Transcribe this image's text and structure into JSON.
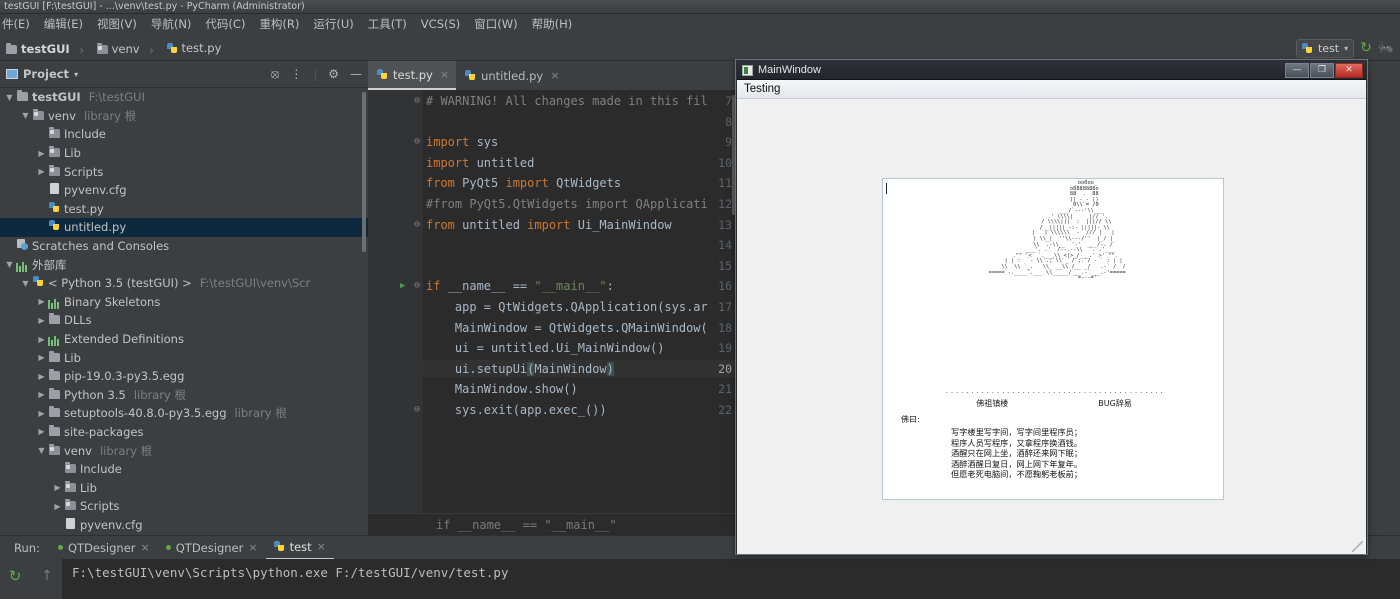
{
  "window": {
    "title": "testGUI [F:\\testGUI] - ...\\venv\\test.py - PyCharm (Administrator)"
  },
  "menubar": {
    "items": [
      {
        "label": "件(E)"
      },
      {
        "label": "编辑(E)"
      },
      {
        "label": "视图(V)"
      },
      {
        "label": "导航(N)"
      },
      {
        "label": "代码(C)"
      },
      {
        "label": "重构(R)"
      },
      {
        "label": "运行(U)"
      },
      {
        "label": "工具(T)"
      },
      {
        "label": "VCS(S)"
      },
      {
        "label": "窗口(W)"
      },
      {
        "label": "帮助(H)"
      }
    ]
  },
  "breadcrumb": {
    "items": [
      {
        "label": "testGUI",
        "icon": "folder-icon"
      },
      {
        "label": "venv",
        "icon": "folder-icon"
      },
      {
        "label": "test.py",
        "icon": "python-file-icon"
      }
    ],
    "separator": "›"
  },
  "toolbar_right": {
    "run_config": "test",
    "dropdown_caret": "▾",
    "rerun_icon": "rerun-icon",
    "debug_icon": "debug-icon"
  },
  "project_panel": {
    "title": "Project",
    "caret": "▾",
    "tools": [
      "target-icon",
      "collapse-all-icon",
      "settings-icon",
      "hide-icon"
    ],
    "tree": [
      {
        "depth": 0,
        "arrow": "▼",
        "icon": "folder-icon",
        "label": "testGUI",
        "bold": true,
        "hint": "F:\\testGUI",
        "sel": false
      },
      {
        "depth": 1,
        "arrow": "▼",
        "icon": "venv-folder-icon",
        "label": "venv",
        "bold": false,
        "hint": "library 根",
        "sel": false
      },
      {
        "depth": 2,
        "arrow": "",
        "icon": "venv-folder-icon",
        "label": "Include",
        "bold": false,
        "hint": "",
        "sel": false
      },
      {
        "depth": 2,
        "arrow": "▶",
        "icon": "venv-folder-icon",
        "label": "Lib",
        "bold": false,
        "hint": "",
        "sel": false
      },
      {
        "depth": 2,
        "arrow": "▶",
        "icon": "venv-folder-icon",
        "label": "Scripts",
        "bold": false,
        "hint": "",
        "sel": false
      },
      {
        "depth": 2,
        "arrow": "",
        "icon": "config-file-icon",
        "label": "pyvenv.cfg",
        "bold": false,
        "hint": "",
        "sel": false
      },
      {
        "depth": 2,
        "arrow": "",
        "icon": "python-file-icon",
        "label": "test.py",
        "bold": false,
        "hint": "",
        "sel": false
      },
      {
        "depth": 2,
        "arrow": "",
        "icon": "python-file-icon",
        "label": "untitled.py",
        "bold": false,
        "hint": "",
        "sel": true
      },
      {
        "depth": 0,
        "arrow": "",
        "icon": "scratches-icon",
        "label": "Scratches and Consoles",
        "bold": false,
        "hint": "",
        "sel": false
      },
      {
        "depth": 0,
        "arrow": "▼",
        "icon": "library-icon",
        "label": "外部库",
        "bold": false,
        "hint": "",
        "sel": false
      },
      {
        "depth": 1,
        "arrow": "▼",
        "icon": "python-file-icon",
        "label": "< Python 3.5 (testGUI) >",
        "bold": false,
        "hint": "F:\\testGUI\\venv\\Scr",
        "sel": false
      },
      {
        "depth": 2,
        "arrow": "▶",
        "icon": "library-icon",
        "label": "Binary Skeletons",
        "bold": false,
        "hint": "",
        "sel": false
      },
      {
        "depth": 2,
        "arrow": "▶",
        "icon": "folder-icon",
        "label": "DLLs",
        "bold": false,
        "hint": "",
        "sel": false
      },
      {
        "depth": 2,
        "arrow": "▶",
        "icon": "library-icon",
        "label": "Extended Definitions",
        "bold": false,
        "hint": "",
        "sel": false
      },
      {
        "depth": 2,
        "arrow": "▶",
        "icon": "folder-icon",
        "label": "Lib",
        "bold": false,
        "hint": "",
        "sel": false
      },
      {
        "depth": 2,
        "arrow": "▶",
        "icon": "folder-icon",
        "label": "pip-19.0.3-py3.5.egg",
        "bold": false,
        "hint": "",
        "sel": false
      },
      {
        "depth": 2,
        "arrow": "▶",
        "icon": "folder-icon",
        "label": "Python 3.5",
        "bold": false,
        "hint": "library 根",
        "sel": false
      },
      {
        "depth": 2,
        "arrow": "▶",
        "icon": "folder-icon",
        "label": "setuptools-40.8.0-py3.5.egg",
        "bold": false,
        "hint": "library 根",
        "sel": false
      },
      {
        "depth": 2,
        "arrow": "▶",
        "icon": "folder-icon",
        "label": "site-packages",
        "bold": false,
        "hint": "",
        "sel": false
      },
      {
        "depth": 2,
        "arrow": "▼",
        "icon": "venv-folder-icon",
        "label": "venv",
        "bold": false,
        "hint": "library 根",
        "sel": false
      },
      {
        "depth": 3,
        "arrow": "",
        "icon": "venv-folder-icon",
        "label": "Include",
        "bold": false,
        "hint": "",
        "sel": false
      },
      {
        "depth": 3,
        "arrow": "▶",
        "icon": "venv-folder-icon",
        "label": "Lib",
        "bold": false,
        "hint": "",
        "sel": false
      },
      {
        "depth": 3,
        "arrow": "▶",
        "icon": "venv-folder-icon",
        "label": "Scripts",
        "bold": false,
        "hint": "",
        "sel": false
      },
      {
        "depth": 3,
        "arrow": "",
        "icon": "config-file-icon",
        "label": "pyvenv.cfg",
        "bold": false,
        "hint": "",
        "sel": false
      }
    ]
  },
  "editor": {
    "tabs": [
      {
        "label": "test.py",
        "active": true,
        "close": "×"
      },
      {
        "label": "untitled.py",
        "active": false,
        "close": "×"
      }
    ],
    "lines": [
      {
        "num": "7",
        "text": "# WARNING! All changes made in this fil",
        "type": "comment",
        "fold": "⊖"
      },
      {
        "num": "8",
        "text": "",
        "type": "plain",
        "fold": ""
      },
      {
        "num": "9",
        "text": "import sys",
        "type": "import",
        "fold": "⊖"
      },
      {
        "num": "10",
        "text": "import untitled",
        "type": "import",
        "fold": ""
      },
      {
        "num": "11",
        "text": "from PyQt5 import QtWidgets",
        "type": "fromimport",
        "fold": ""
      },
      {
        "num": "12",
        "text": "#from PyQt5.QtWidgets import QApplicati",
        "type": "comment",
        "fold": ""
      },
      {
        "num": "13",
        "text": "from untitled import Ui_MainWindow",
        "type": "fromimport",
        "fold": "⊖"
      },
      {
        "num": "14",
        "text": "",
        "type": "plain",
        "fold": ""
      },
      {
        "num": "15",
        "text": "",
        "type": "plain",
        "fold": ""
      },
      {
        "num": "16",
        "text": "if __name__ == \"__main__\":",
        "type": "ifmain",
        "fold": "⊖",
        "gutter_run": "▶"
      },
      {
        "num": "17",
        "text": "    app = QtWidgets.QApplication(sys.ar",
        "type": "plain",
        "fold": ""
      },
      {
        "num": "18",
        "text": "    MainWindow = QtWidgets.QMainWindow(",
        "type": "plain",
        "fold": ""
      },
      {
        "num": "19",
        "text": "    ui = untitled.Ui_MainWindow()",
        "type": "plain",
        "fold": ""
      },
      {
        "num": "20",
        "text": "    ui.setupUi(MainWindow)",
        "type": "current",
        "fold": ""
      },
      {
        "num": "21",
        "text": "    MainWindow.show()",
        "type": "plain",
        "fold": ""
      },
      {
        "num": "22",
        "text": "    sys.exit(app.exec_())",
        "type": "plain",
        "fold": "⊖"
      }
    ],
    "status_preview": "if __name__ == \"__main__\""
  },
  "run_panel": {
    "label": "Run:",
    "tabs": [
      {
        "label": "QTDesigner",
        "active": false,
        "close": "×",
        "status_dot": true
      },
      {
        "label": "QTDesigner",
        "active": false,
        "close": "×",
        "status_dot": true
      },
      {
        "label": "test",
        "active": true,
        "close": "×",
        "status_dot": false
      }
    ],
    "gutter_icons": [
      "rerun-icon",
      "scroll-up-icon"
    ],
    "console_text": "F:\\testGUI\\venv\\Scripts\\python.exe F:/testGUI/venv/test.py"
  },
  "qt_window": {
    "title": "MainWindow",
    "buttons": {
      "minimize": "—",
      "maximize": "❐",
      "close": "✕"
    },
    "menu_items": [
      "Testing"
    ],
    "ascii_art": "                    _oo0oo_\n                   o8888888o\n                   88  .  88\n                   (| -_- |)\n                    0\\\\ = /0\n                 ___/`---'\\\\___\n               .' \\\\\\\\|     |// '.\n              / \\\\\\\\|||  :  |||// \\\\\n             / _||||| -:- |||||- \\\\\n            |   | \\\\\\\\\\\\  -  /// |   |\n            | \\\\_|  ''\\\\---/''  |_/ |\n            \\\\  .-\\\\__  '-'  ___/-. /\n          ___'. .'  /--.--\\\\  `. .'___\n       .\"\" '<  `.___\\\\_<|>_/___.' >' \"\".\n      | | :  `- \\\\`.;`\\\\ _ /`;.`/ - ` : | |\n      \\\\  \\\\ `_.   \\\\_ __\\\\ /__ _/   .-` /  /\n  =====`-.____`.___ \\\\_____/___.-`___.-'=====\n                    `=---='",
    "dots_line": "...........................................",
    "caption_left": "佛祖镇楼",
    "caption_right": "BUG辞易",
    "buddha_says": "佛曰:",
    "poem": "写字楼里写字间，写字间里程序员；\n程序人员写程序，又拿程序换酒钱。\n酒醒只在网上坐，酒醉还来网下眠；\n酒醉酒醒日复日，网上网下年复年。\n但愿老死电脑间，不愿鞠躬老板前；"
  }
}
